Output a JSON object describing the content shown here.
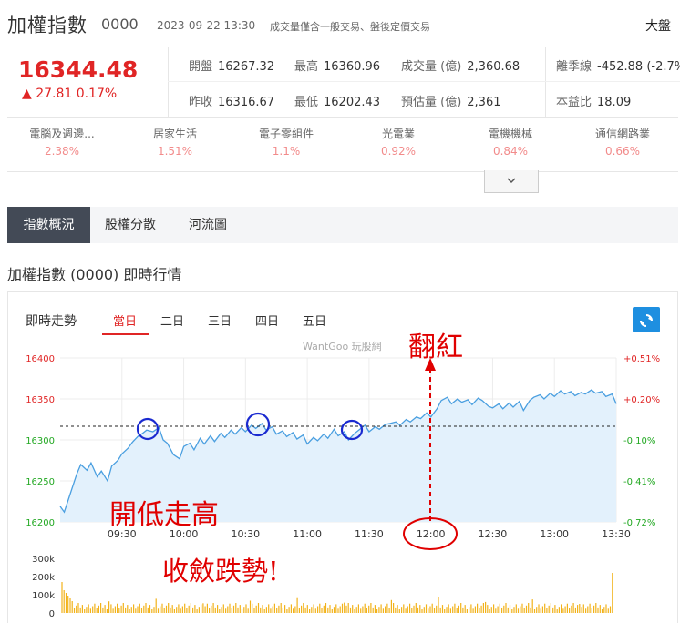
{
  "header": {
    "title": "加權指數",
    "code": "0000",
    "datetime": "2023-09-22 13:30",
    "note": "成交量僅含一般交易、盤後定價交易",
    "right_text": "大盤"
  },
  "quote": {
    "price": "16344.48",
    "change": "▲ 27.81  0.17%"
  },
  "stats": {
    "open_label": "開盤",
    "open": "16267.32",
    "high_label": "最高",
    "high": "16360.96",
    "volume_label": "成交量 (億)",
    "volume": "2,360.68",
    "season_label": "離季線",
    "season": "-452.88 (-2.7%",
    "prev_label": "昨收",
    "prev": "16316.67",
    "low_label": "最低",
    "low": "16202.43",
    "est_label": "預估量 (億)",
    "est": "2,361",
    "pe_label": "本益比",
    "pe": "18.09"
  },
  "sectors": [
    {
      "name": "電腦及週邊...",
      "value": "2.38%"
    },
    {
      "name": "居家生活",
      "value": "1.51%"
    },
    {
      "name": "電子零組件",
      "value": "1.1%"
    },
    {
      "name": "光電業",
      "value": "0.92%"
    },
    {
      "name": "電機機械",
      "value": "0.84%"
    },
    {
      "name": "通信網路業",
      "value": "0.66%"
    }
  ],
  "expand_icon": "chevron-down-icon",
  "tabs": [
    "指數概況",
    "股權分散",
    "河流圖"
  ],
  "section_title": "加權指數 (0000) 即時行情",
  "chart_header": {
    "title": "即時走勢",
    "ranges": [
      "當日",
      "二日",
      "三日",
      "四日",
      "五日"
    ],
    "watermark": "WantGoo 玩股網",
    "refresh_icon": "refresh-icon"
  },
  "annotations": {
    "rise": "翻紅",
    "open_low": "開低走高",
    "narrow": "收斂跌勢!"
  },
  "colors": {
    "up": "#e02525",
    "down": "#22a822",
    "line": "#4a9fe0",
    "fill": "#e3f1fc",
    "volume": "#f2b21a",
    "annotation": "#e00000",
    "circle": "#1a2ad0"
  },
  "chart_data": {
    "type": "line",
    "title": "",
    "ylabel": "",
    "xlabel": "",
    "x_ticks": [
      "09:30",
      "10:00",
      "10:30",
      "11:00",
      "11:30",
      "12:00",
      "12:30",
      "13:00",
      "13:30"
    ],
    "x_range": [
      "09:00",
      "13:30"
    ],
    "y_ticks": [
      16200,
      16250,
      16300,
      16350,
      16400
    ],
    "y_ticks_labels": [
      "16200",
      "16250",
      "16300",
      "16350",
      "16400"
    ],
    "ylim": [
      16200,
      16400
    ],
    "right_ticks": [
      "-0.72%",
      "-0.41%",
      "-0.10%",
      "+0.20%",
      "+0.51%"
    ],
    "reference": 16316.67,
    "series": [
      {
        "x": [
          "09:00",
          "09:02",
          "09:05",
          "09:08",
          "09:10",
          "09:13",
          "09:15",
          "09:18",
          "09:20",
          "09:23",
          "09:25",
          "09:28",
          "09:30",
          "09:33",
          "09:35",
          "09:38",
          "09:40",
          "09:42",
          "09:45",
          "09:48",
          "09:50",
          "09:52",
          "09:55",
          "09:58",
          "10:00",
          "10:03",
          "10:05",
          "10:08",
          "10:10",
          "10:13",
          "10:15",
          "10:18",
          "10:20",
          "10:23",
          "10:25",
          "10:28",
          "10:30",
          "10:33",
          "10:35",
          "10:38",
          "10:40",
          "10:43",
          "10:45",
          "10:48",
          "10:50",
          "10:53",
          "10:55",
          "10:58",
          "11:00",
          "11:03",
          "11:05",
          "11:08",
          "11:10",
          "11:13",
          "11:15",
          "11:18",
          "11:20",
          "11:23",
          "11:25",
          "11:28",
          "11:30",
          "11:33",
          "11:35",
          "11:38",
          "11:40",
          "11:43",
          "11:45",
          "11:48",
          "11:50",
          "11:53",
          "11:55",
          "11:58",
          "12:00",
          "12:03",
          "12:05",
          "12:08",
          "12:10",
          "12:13",
          "12:15",
          "12:18",
          "12:20",
          "12:23",
          "12:25",
          "12:28",
          "12:30",
          "12:33",
          "12:35",
          "12:38",
          "12:40",
          "12:43",
          "12:45",
          "12:48",
          "12:50",
          "12:53",
          "12:55",
          "12:58",
          "13:00",
          "13:03",
          "13:05",
          "13:08",
          "13:10",
          "13:13",
          "13:15",
          "13:18",
          "13:20",
          "13:23",
          "13:25",
          "13:28",
          "13:30"
        ],
        "values": [
          16219,
          16212,
          16235,
          16258,
          16270,
          16263,
          16272,
          16255,
          16262,
          16250,
          16268,
          16275,
          16283,
          16290,
          16297,
          16305,
          16308,
          16312,
          16310,
          16315,
          16300,
          16296,
          16282,
          16277,
          16292,
          16296,
          16288,
          16302,
          16295,
          16305,
          16298,
          16308,
          16303,
          16312,
          16307,
          16315,
          16310,
          16318,
          16314,
          16320,
          16312,
          16316,
          16307,
          16311,
          16304,
          16309,
          16301,
          16306,
          16295,
          16303,
          16299,
          16307,
          16302,
          16313,
          16305,
          16310,
          16300,
          16308,
          16312,
          16318,
          16310,
          16316,
          16313,
          16319,
          16320,
          16322,
          16318,
          16325,
          16322,
          16328,
          16326,
          16333,
          16328,
          16338,
          16348,
          16352,
          16344,
          16350,
          16346,
          16349,
          16343,
          16351,
          16348,
          16341,
          16339,
          16344,
          16338,
          16345,
          16340,
          16347,
          16336,
          16348,
          16352,
          16355,
          16350,
          16357,
          16353,
          16360,
          16356,
          16359,
          16354,
          16358,
          16356,
          16361,
          16357,
          16359,
          16353,
          16356,
          16344
        ]
      }
    ],
    "volume": {
      "ylim": [
        0,
        300000
      ],
      "y_ticks_labels": [
        "0",
        "100k",
        "200k",
        "300k"
      ]
    }
  }
}
